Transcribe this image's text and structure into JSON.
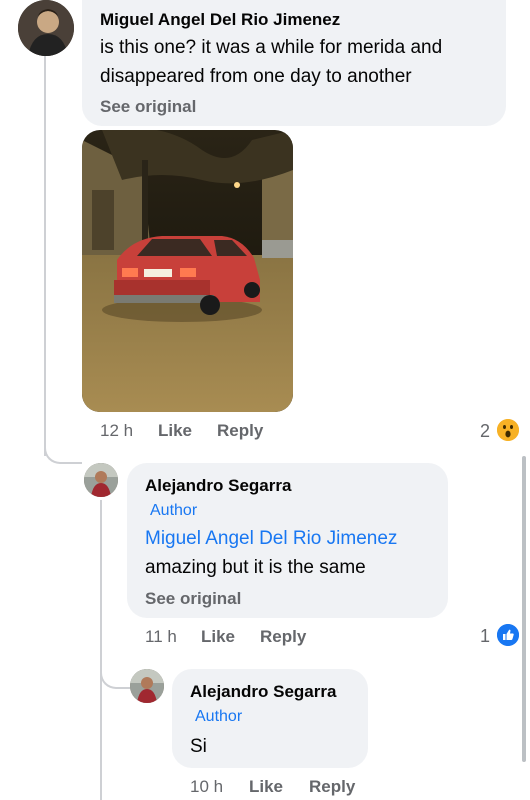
{
  "comments": [
    {
      "author": "Miguel Angel Del Rio Jimenez",
      "text_lines": [
        "is this one? it was a while for merida and",
        "disappeared from one day to another"
      ],
      "see_original": "See original",
      "time": "12 h",
      "like": "Like",
      "reply": "Reply",
      "reaction_count": "2",
      "reaction_icon": "wow-emoji-icon",
      "has_photo": true
    },
    {
      "author": "Alejandro Segarra",
      "author_badge": "Author",
      "mention": "Miguel Angel Del Rio Jimenez",
      "text": "amazing but it is the same",
      "see_original": "See original",
      "time": "11 h",
      "like": "Like",
      "reply": "Reply",
      "reaction_count": "1",
      "reaction_icon": "like-thumb-icon"
    },
    {
      "author": "Alejandro Segarra",
      "author_badge": "Author",
      "text": "Si",
      "time": "10 h",
      "like": "Like",
      "reply": "Reply"
    }
  ],
  "colors": {
    "link": "#1877f2",
    "bubble": "#f0f2f5",
    "meta": "#65676b",
    "wow": "#f7b125"
  }
}
